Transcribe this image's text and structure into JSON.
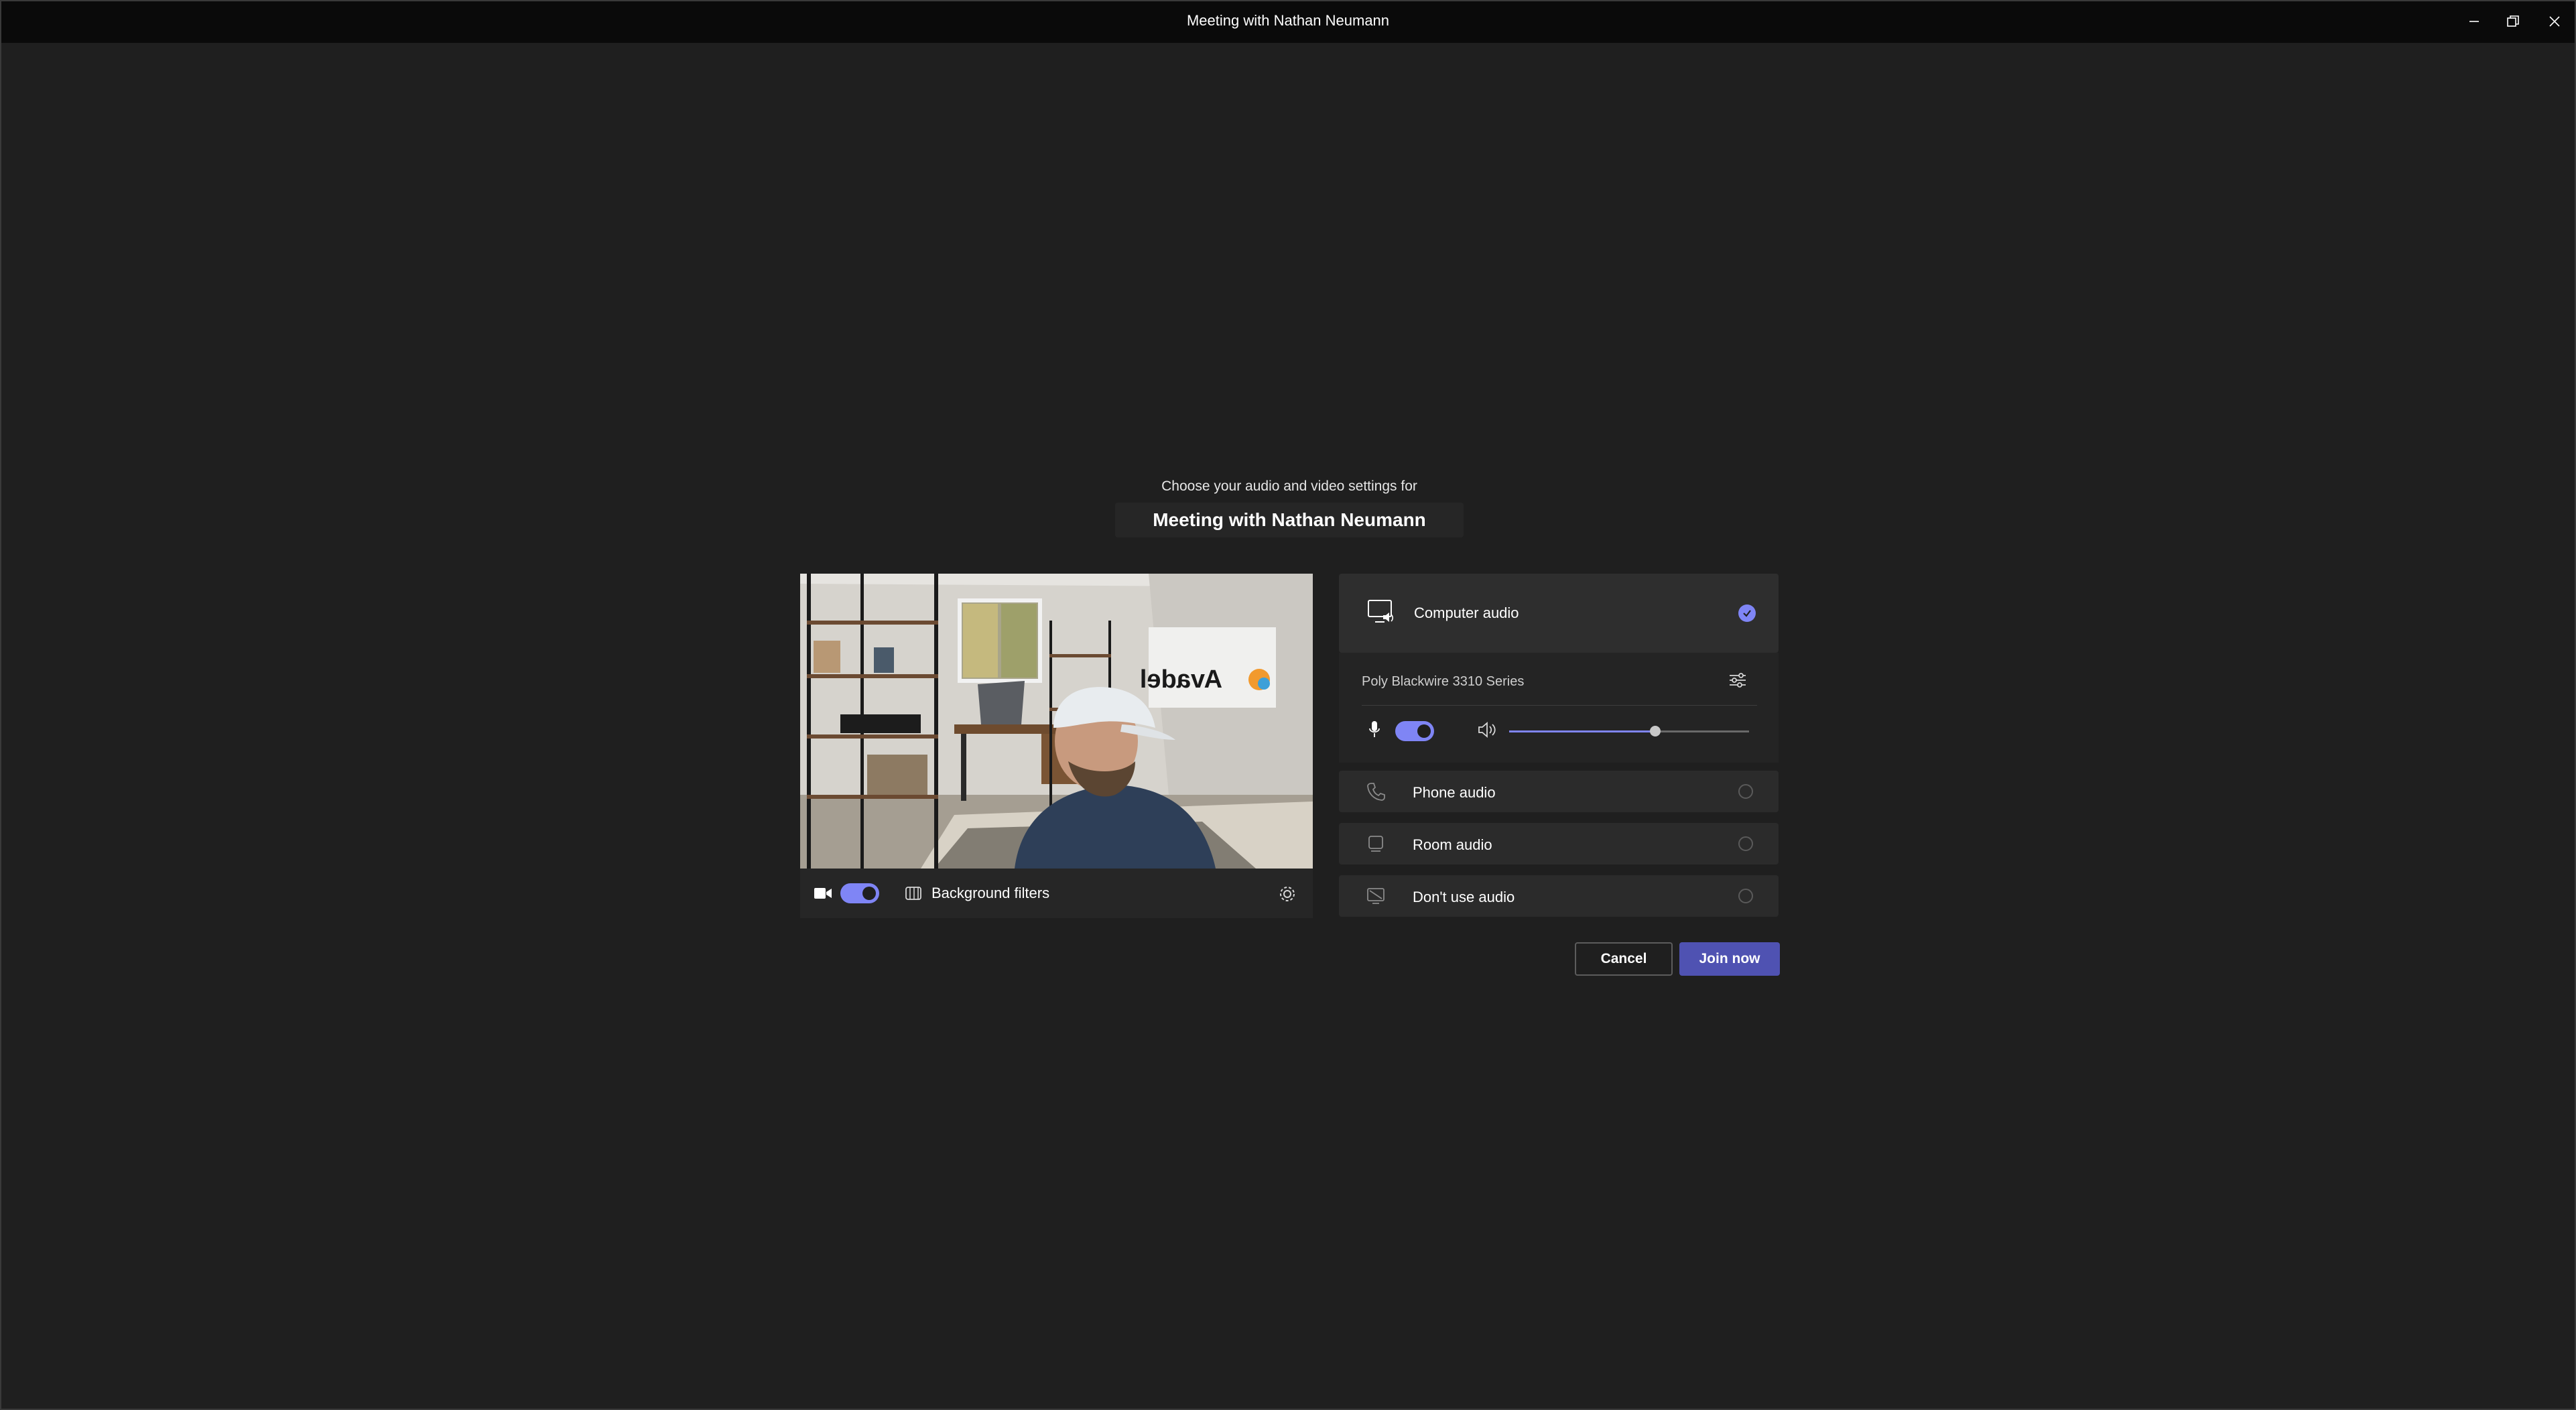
{
  "window": {
    "title": "Meeting with Nathan Neumann",
    "controls": [
      "minimize",
      "maximize",
      "close"
    ]
  },
  "prejoin": {
    "subtitle": "Choose your audio and video settings for",
    "meeting_title": "Meeting with Nathan Neumann"
  },
  "video": {
    "camera_on": true,
    "background_filters_label": "Background filters",
    "wall_sign_text": "Avadel"
  },
  "audio": {
    "options": [
      {
        "label": "Computer audio",
        "selected": true
      },
      {
        "label": "Phone audio",
        "selected": false
      },
      {
        "label": "Room audio",
        "selected": false
      },
      {
        "label": "Don't use audio",
        "selected": false
      }
    ],
    "device_name": "Poly Blackwire 3310 Series",
    "mic_on": true,
    "speaker_volume": 0.61
  },
  "actions": {
    "cancel_label": "Cancel",
    "join_label": "Join now"
  },
  "colors": {
    "accent": "#7f85f5",
    "primary_button": "#4f52b2",
    "background": "#1f1f1f",
    "titlebar": "#0a0a0a"
  }
}
